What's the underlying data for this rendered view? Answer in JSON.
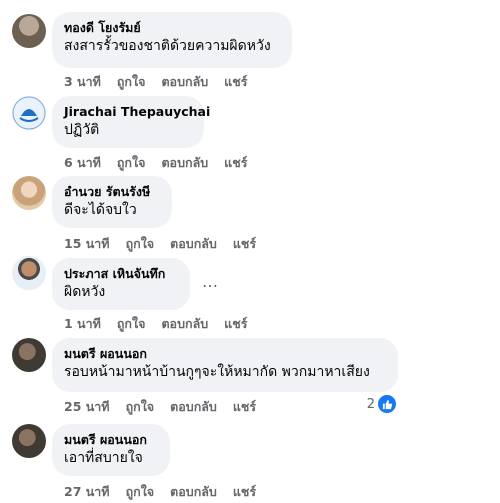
{
  "comments": [
    {
      "author": "ทองดี โยงรัมย์",
      "text": "สงสารรั้วของชาติด้วยความผิดหวัง",
      "time": "3 นาที"
    },
    {
      "author": "Jirachai Thepauychai",
      "text": "ปฏิวัติ",
      "time": "6 นาที"
    },
    {
      "author": "อำนวย รัตนรังษี",
      "text": "ดีจะได้จบใว",
      "time": "15 นาที"
    },
    {
      "author": "ประภาส เหินจันทึก",
      "text": "ผิดหวัง",
      "time": "1 นาที"
    },
    {
      "author": "มนตรี ผอนนอก",
      "text": "รอบหน้ามาหน้าบ้านกูๆจะให้หมากัด พวกมาหาเสียง",
      "time": "25 นาที",
      "reaction_count": "2"
    },
    {
      "author": "มนตรี ผอนนอก",
      "text": "เอาที่สบายใจ",
      "time": "27 นาที"
    }
  ],
  "actions": {
    "like": "ถูกใจ",
    "reply": "ตอบกลับ",
    "share": "แชร์"
  },
  "more_glyph": "…",
  "colors": {
    "bubble": "#f0f2f5",
    "meta": "#65676b",
    "like_blue": "#1877f2"
  }
}
